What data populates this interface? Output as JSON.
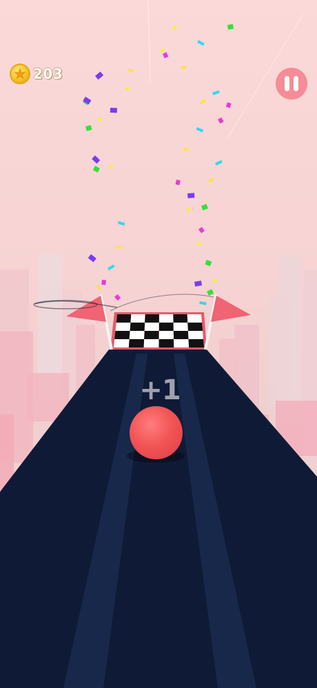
{
  "hud": {
    "coins": "203",
    "coin_icon": "star-coin-icon",
    "pause_icon": "pause-icon"
  },
  "game": {
    "score_popup": "+1",
    "player": "red-ball",
    "finish": "checkered-finish-flag"
  },
  "colors": {
    "sky": "#f8d6d6",
    "track": "#0f1b36",
    "ball": "#f25555",
    "pause_button": "#f58c96",
    "flag": "#f06474"
  }
}
